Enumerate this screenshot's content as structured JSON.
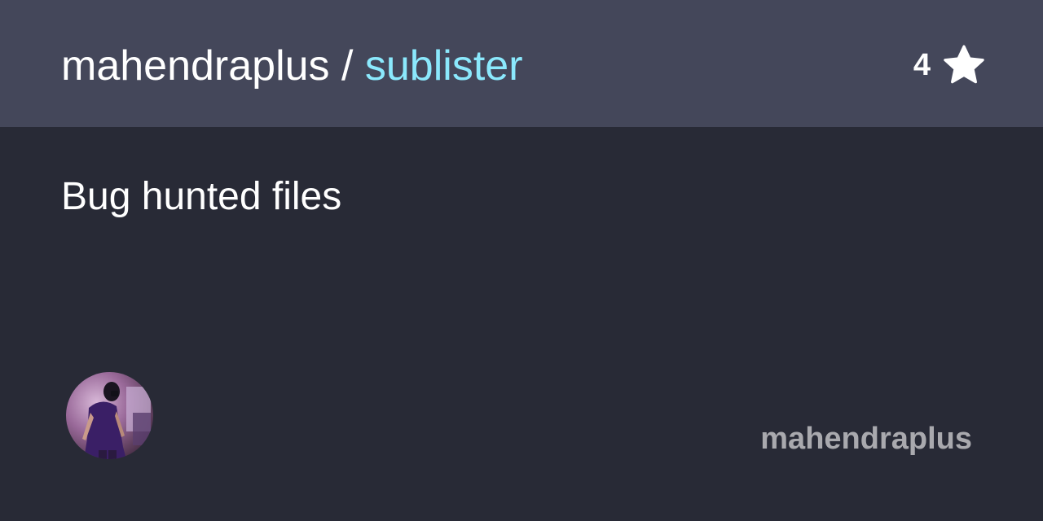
{
  "header": {
    "owner": "mahendraplus",
    "separator": " / ",
    "repo": "sublister",
    "star_count": "4"
  },
  "description": "Bug hunted files",
  "footer": {
    "username": "mahendraplus",
    "avatar_icon": "user-avatar"
  },
  "colors": {
    "background": "#282a36",
    "header_background": "#44475a",
    "repo_accent": "#8be9fd",
    "text": "#ffffff",
    "username_text": "#a9a9ae"
  }
}
